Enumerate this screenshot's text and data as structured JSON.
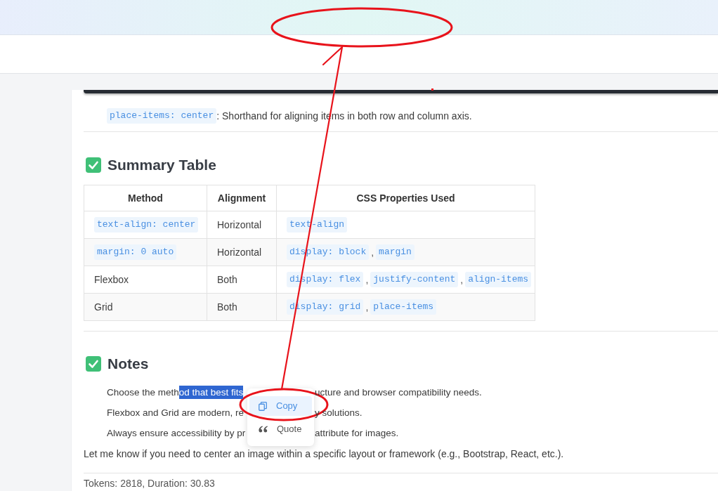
{
  "document": [
    {
      "kind": "code_end"
    },
    {
      "kind": "list",
      "items": [
        {
          "code": "place-items: center",
          "text": ": Shorthand for aligning items in both row and column axis."
        }
      ]
    },
    {
      "kind": "rule"
    },
    {
      "kind": "heading",
      "text": "Summary Table"
    },
    {
      "kind": "table",
      "columns": [
        "Method",
        "Alignment",
        "CSS Properties Used"
      ],
      "rows": [
        [
          [
            {
              "kind": "code",
              "text": "text-align: center"
            }
          ],
          [
            {
              "kind": "text",
              "text": "Horizontal"
            }
          ],
          [
            {
              "kind": "code",
              "text": "text-align"
            }
          ]
        ],
        [
          [
            {
              "kind": "code",
              "text": "margin: 0 auto"
            }
          ],
          [
            {
              "kind": "text",
              "text": "Horizontal"
            }
          ],
          [
            {
              "kind": "code",
              "text": "display: block"
            },
            {
              "kind": "text",
              "text": ","
            },
            {
              "kind": "code",
              "text": "margin"
            }
          ]
        ],
        [
          [
            {
              "kind": "text",
              "text": "Flexbox"
            }
          ],
          [
            {
              "kind": "text",
              "text": "Both"
            }
          ],
          [
            {
              "kind": "code",
              "text": "display: flex"
            },
            {
              "kind": "text",
              "text": ","
            },
            {
              "kind": "code",
              "text": "justify-content"
            },
            {
              "kind": "text",
              "text": ","
            },
            {
              "kind": "code",
              "text": "align-items"
            }
          ]
        ],
        [
          [
            {
              "kind": "text",
              "text": "Grid"
            }
          ],
          [
            {
              "kind": "text",
              "text": "Both"
            }
          ],
          [
            {
              "kind": "code",
              "text": "display: grid"
            },
            {
              "kind": "text",
              "text": ","
            },
            {
              "kind": "code",
              "text": "place-items"
            }
          ]
        ]
      ]
    },
    {
      "kind": "rule"
    },
    {
      "kind": "heading",
      "text": "Notes"
    },
    {
      "kind": "notes",
      "items": [
        {
          "lead": "Choose the meth",
          "highlighted_text": "od that best fits",
          "trail": "ucture and browser compatibility needs."
        },
        {
          "lead": "Flexbox and Grid are modern, re",
          "trail": "y solutions."
        },
        {
          "lead": "Always ensure accessibility by pr",
          "trail": "attribute for images."
        }
      ]
    },
    {
      "kind": "paragraph",
      "text": "Let me know if you need to center an image within a specific layout or framework (e.g., Bootstrap, React, etc.)."
    },
    {
      "kind": "rule"
    },
    {
      "kind": "meta",
      "text": "Tokens: 2818, Duration: 30.83"
    }
  ],
  "context_menu": {
    "items": [
      {
        "kind": "copy",
        "label": "Copy",
        "highlighted": true
      },
      {
        "kind": "quote",
        "label": "Quote",
        "highlighted": false
      }
    ]
  },
  "annotations": [
    {
      "kind": "ellipse"
    },
    {
      "kind": "arrow"
    },
    {
      "kind": "ellipse"
    },
    {
      "kind": "dot"
    }
  ]
}
